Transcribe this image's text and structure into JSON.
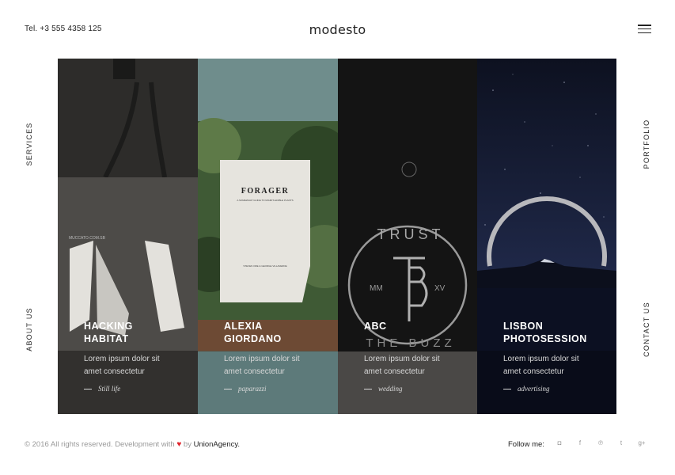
{
  "header": {
    "phone": "Tel. +3 555 4358 125",
    "logo": "modesto",
    "menu_icon": "hamburger-menu-icon"
  },
  "side_nav": {
    "services": "SERVICES",
    "about": "ABOUT US",
    "portfolio": "PORTFOLIO",
    "contact": "CONTACT US"
  },
  "panels": [
    {
      "title_1": "HACKING",
      "title_2": "HABITAT",
      "desc_1": "Lorem ipsum dolor sit",
      "desc_2": "amet consectetur",
      "tag": "Still life",
      "color": "#2d2c2a",
      "mock_text": "MUCCATO.COM.SB"
    },
    {
      "title_1": "ALEXIA",
      "title_2": "GIORDANO",
      "desc_1": "Lorem ipsum dolor sit",
      "desc_2": "amet consectetur",
      "tag": "paparazzi",
      "color": "#6f8d8c",
      "book_title": "FORAGER",
      "book_sub": "A SOMEWHAT GUIDE TO MIAMI'S EDIBLE PLANTS",
      "book_author": "STEVEN ORE & GEORGE VILLAVERDE"
    },
    {
      "title_1": "ABC",
      "title_2": "",
      "desc_1": "Lorem ipsum dolor sit",
      "desc_2": "amet consectetur",
      "tag": "wedding",
      "color": "#161616",
      "badge_top": "TRUST",
      "badge_bottom": "THE BUZZ",
      "badge_left": "MM",
      "badge_right": "XV"
    },
    {
      "title_1": "LISBON",
      "title_2": "PHOTOSESSION",
      "desc_1": "Lorem ipsum dolor sit",
      "desc_2": "amet consectetur",
      "tag": "advertising",
      "color": "#141a2c"
    }
  ],
  "footer": {
    "copyright": "© 2016 All rights reserved. Development with",
    "by": "by",
    "agency": "UnionAgency.",
    "follow": "Follow me:",
    "social": [
      "instagram-icon",
      "facebook-icon",
      "pinterest-icon",
      "twitter-icon",
      "google-plus-icon"
    ],
    "social_glyphs": [
      "◘",
      "f",
      "℗",
      "t",
      "g+"
    ]
  },
  "colors": {
    "heart": "#e0242b",
    "accent_text": "#222222"
  }
}
